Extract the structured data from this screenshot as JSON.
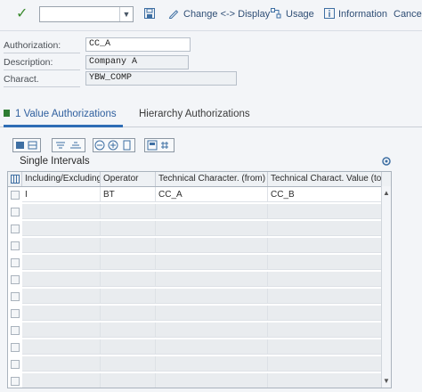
{
  "toolbar": {
    "confirm_icon": "checkmark-icon",
    "command_field_value": "",
    "change_display_label": "Change <-> Display",
    "usage_label": "Usage",
    "information_label": "Information",
    "cancel_label": "Cancel"
  },
  "form": {
    "authorization_label": "Authorization:",
    "authorization_value": "CC_A",
    "description_label": "Description:",
    "description_value": "Company A",
    "charact_label": "Charact.",
    "charact_value": "YBW_COMP"
  },
  "tabs": [
    {
      "label": "1 Value Authorizations",
      "active": true
    },
    {
      "label": "Hierarchy Authorizations",
      "active": false
    }
  ],
  "section": {
    "title": "Single Intervals"
  },
  "table": {
    "columns": [
      "Including/Excluding",
      "Operator",
      "Technical Character. (from)",
      "Technical Charact. Value (to)"
    ],
    "rows": [
      [
        "I",
        "BT",
        "CC_A",
        "CC_B"
      ]
    ]
  },
  "colors": {
    "accent": "#2f6db5",
    "active_mark": "#2e7d32",
    "toolbar_link": "#2f4e75"
  }
}
